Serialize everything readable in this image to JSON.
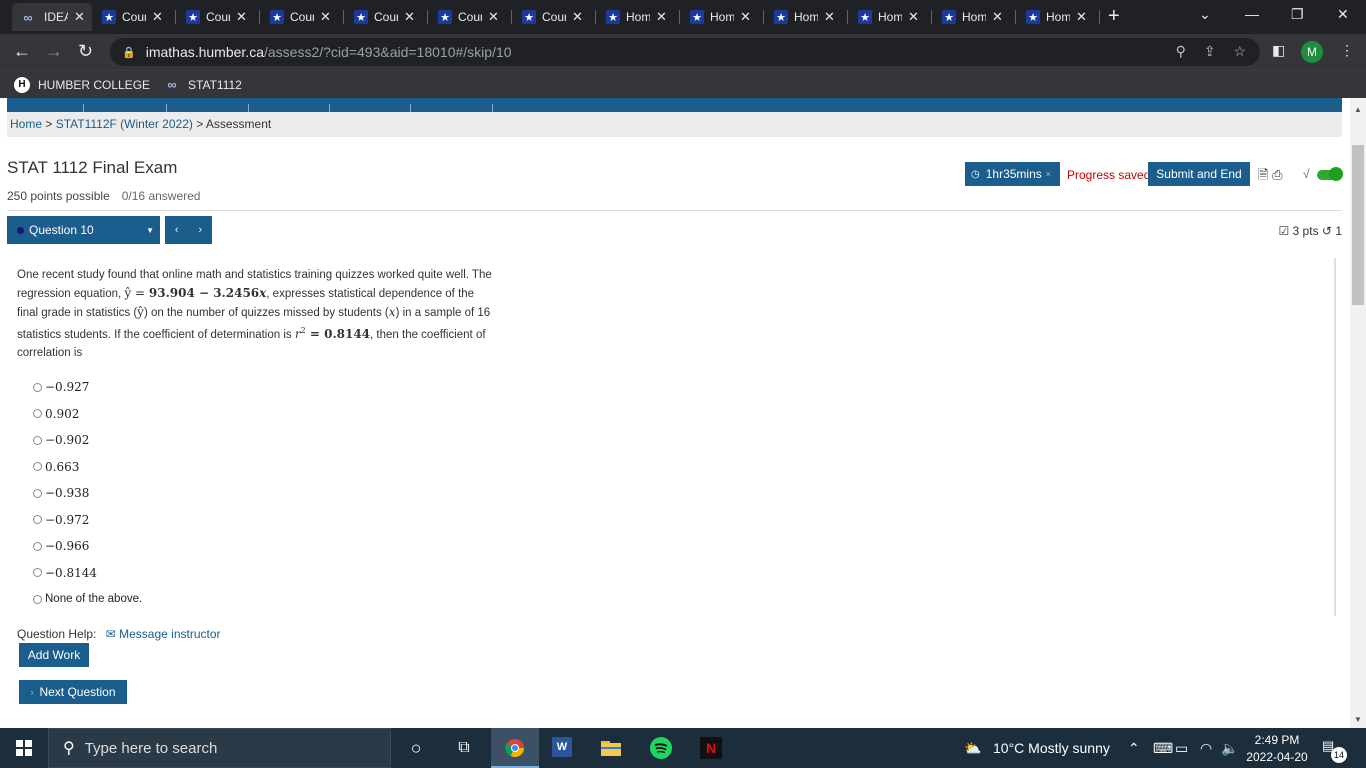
{
  "browser": {
    "tabs": [
      {
        "label": "IDEA",
        "icon": "infinity-icon",
        "active": true
      },
      {
        "label": "Course",
        "icon": "star-icon"
      },
      {
        "label": "Course",
        "icon": "star-icon"
      },
      {
        "label": "Course",
        "icon": "star-icon"
      },
      {
        "label": "Course",
        "icon": "star-icon"
      },
      {
        "label": "Course",
        "icon": "star-icon"
      },
      {
        "label": "Course",
        "icon": "star-icon"
      },
      {
        "label": "Home",
        "icon": "star-icon"
      },
      {
        "label": "Home",
        "icon": "star-icon"
      },
      {
        "label": "Home",
        "icon": "star-icon"
      },
      {
        "label": "Home",
        "icon": "star-icon"
      },
      {
        "label": "Home",
        "icon": "star-icon"
      },
      {
        "label": "Home",
        "icon": "star-icon"
      }
    ],
    "close_glyph": "✕",
    "new_tab_glyph": "+",
    "url_host": "imathas.humber.ca",
    "url_path": "/assess2/?cid=493&aid=18010#/skip/10",
    "avatar_letter": "M",
    "bookmarks": [
      {
        "label": "HUMBER COLLEGE"
      },
      {
        "label": "STAT1112"
      }
    ]
  },
  "breadcrumb": {
    "home": "Home",
    "sep1": " > ",
    "course": "STAT1112F (Winter 2022)",
    "sep2": " > ",
    "current": "Assessment"
  },
  "exam": {
    "title": "STAT 1112 Final Exam",
    "points_possible": "250 points possible",
    "answered": "0/16 answered",
    "timer": "1hr35mins",
    "timer_close": "×",
    "progress_status": "Progress saved",
    "submit_label": "Submit and End",
    "question_select": "Question 10",
    "prev_glyph": "‹",
    "next_glyph": "›",
    "question_points": "3 pts",
    "retries": "1"
  },
  "question": {
    "t1": "One recent study found that online math and statistics training quizzes worked quite well. The regression equation, ",
    "eq_lhs": "ŷ",
    "eq_mid": " = ",
    "eq_rhs": "93.904 − 3.2456",
    "eq_x": "x",
    "t2": ", expresses statistical dependence of the final grade in statistics (",
    "yhat": "ŷ",
    "t3": ") on the number of quizzes missed by students (",
    "xvar": "x",
    "t4": ") in a sample of 16 statistics students. If the coefficient of determination is ",
    "r2_lhs": "r",
    "r2_sup": "2",
    "r2_rhs": " = 0.8144",
    "t5": ", then the coefficient of correlation is"
  },
  "choices": [
    {
      "value": "−0.927",
      "math": true
    },
    {
      "value": "0.902",
      "math": true
    },
    {
      "value": "−0.902",
      "math": true
    },
    {
      "value": "0.663",
      "math": true
    },
    {
      "value": "−0.938",
      "math": true
    },
    {
      "value": "−0.972",
      "math": true
    },
    {
      "value": "−0.966",
      "math": true
    },
    {
      "value": "−0.8144",
      "math": true
    },
    {
      "value": "None of the above.",
      "math": false
    }
  ],
  "help": {
    "label": "Question Help:",
    "message_instructor": "Message instructor"
  },
  "buttons": {
    "add_work": "Add Work",
    "next_question": "Next Question",
    "next_glyph": "›"
  },
  "taskbar": {
    "search_placeholder": "Type here to search",
    "weather": "10°C  Mostly sunny",
    "time": "2:49 PM",
    "date": "2022-04-20",
    "notification_count": "14"
  },
  "colors": {
    "accent": "#1b5d8c",
    "progress_saved": "#cc0000",
    "browser_dark": "#202124"
  }
}
